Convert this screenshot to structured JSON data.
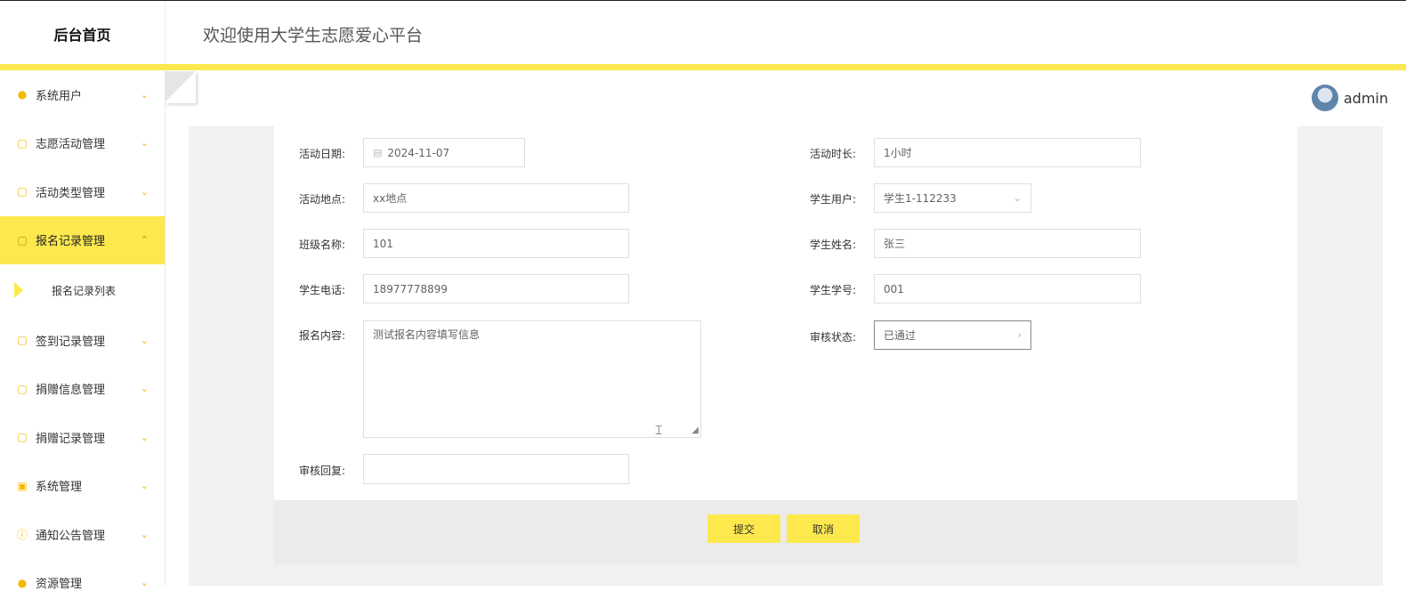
{
  "header": {
    "brand": "后台首页",
    "welcome": "欢迎使用大学生志愿爱心平台"
  },
  "user": {
    "name": "admin"
  },
  "sidebar": {
    "items": [
      {
        "label": "系统用户",
        "icon": "user-icon"
      },
      {
        "label": "志愿活动管理",
        "icon": "doc-icon"
      },
      {
        "label": "活动类型管理",
        "icon": "doc-icon"
      },
      {
        "label": "报名记录管理",
        "icon": "doc-icon",
        "active": true
      },
      {
        "label": "签到记录管理",
        "icon": "doc-icon"
      },
      {
        "label": "捐赠信息管理",
        "icon": "doc-icon"
      },
      {
        "label": "捐赠记录管理",
        "icon": "doc-icon"
      },
      {
        "label": "系统管理",
        "icon": "image-icon"
      },
      {
        "label": "通知公告管理",
        "icon": "info-icon"
      },
      {
        "label": "资源管理",
        "icon": "user-icon"
      }
    ],
    "submenu": {
      "label": "报名记录列表"
    }
  },
  "form": {
    "activity_date": {
      "label": "活动日期:",
      "value": "2024-11-07"
    },
    "activity_duration": {
      "label": "活动时长:",
      "value": "1小时"
    },
    "activity_location": {
      "label": "活动地点:",
      "value": "xx地点"
    },
    "student_user": {
      "label": "学生用户:",
      "value": "学生1-112233"
    },
    "class_name": {
      "label": "班级名称:",
      "value": "101"
    },
    "student_name": {
      "label": "学生姓名:",
      "value": "张三"
    },
    "student_phone": {
      "label": "学生电话:",
      "value": "18977778899"
    },
    "student_id": {
      "label": "学生学号:",
      "value": "001"
    },
    "signup_content": {
      "label": "报名内容:",
      "value": "测试报名内容填写信息"
    },
    "review_status": {
      "label": "审核状态:",
      "value": "已通过"
    },
    "review_reply": {
      "label": "审核回复:",
      "value": ""
    }
  },
  "buttons": {
    "submit": "提交",
    "cancel": "取消"
  },
  "colors": {
    "accent": "#fde84d",
    "icon": "#f5b800"
  }
}
